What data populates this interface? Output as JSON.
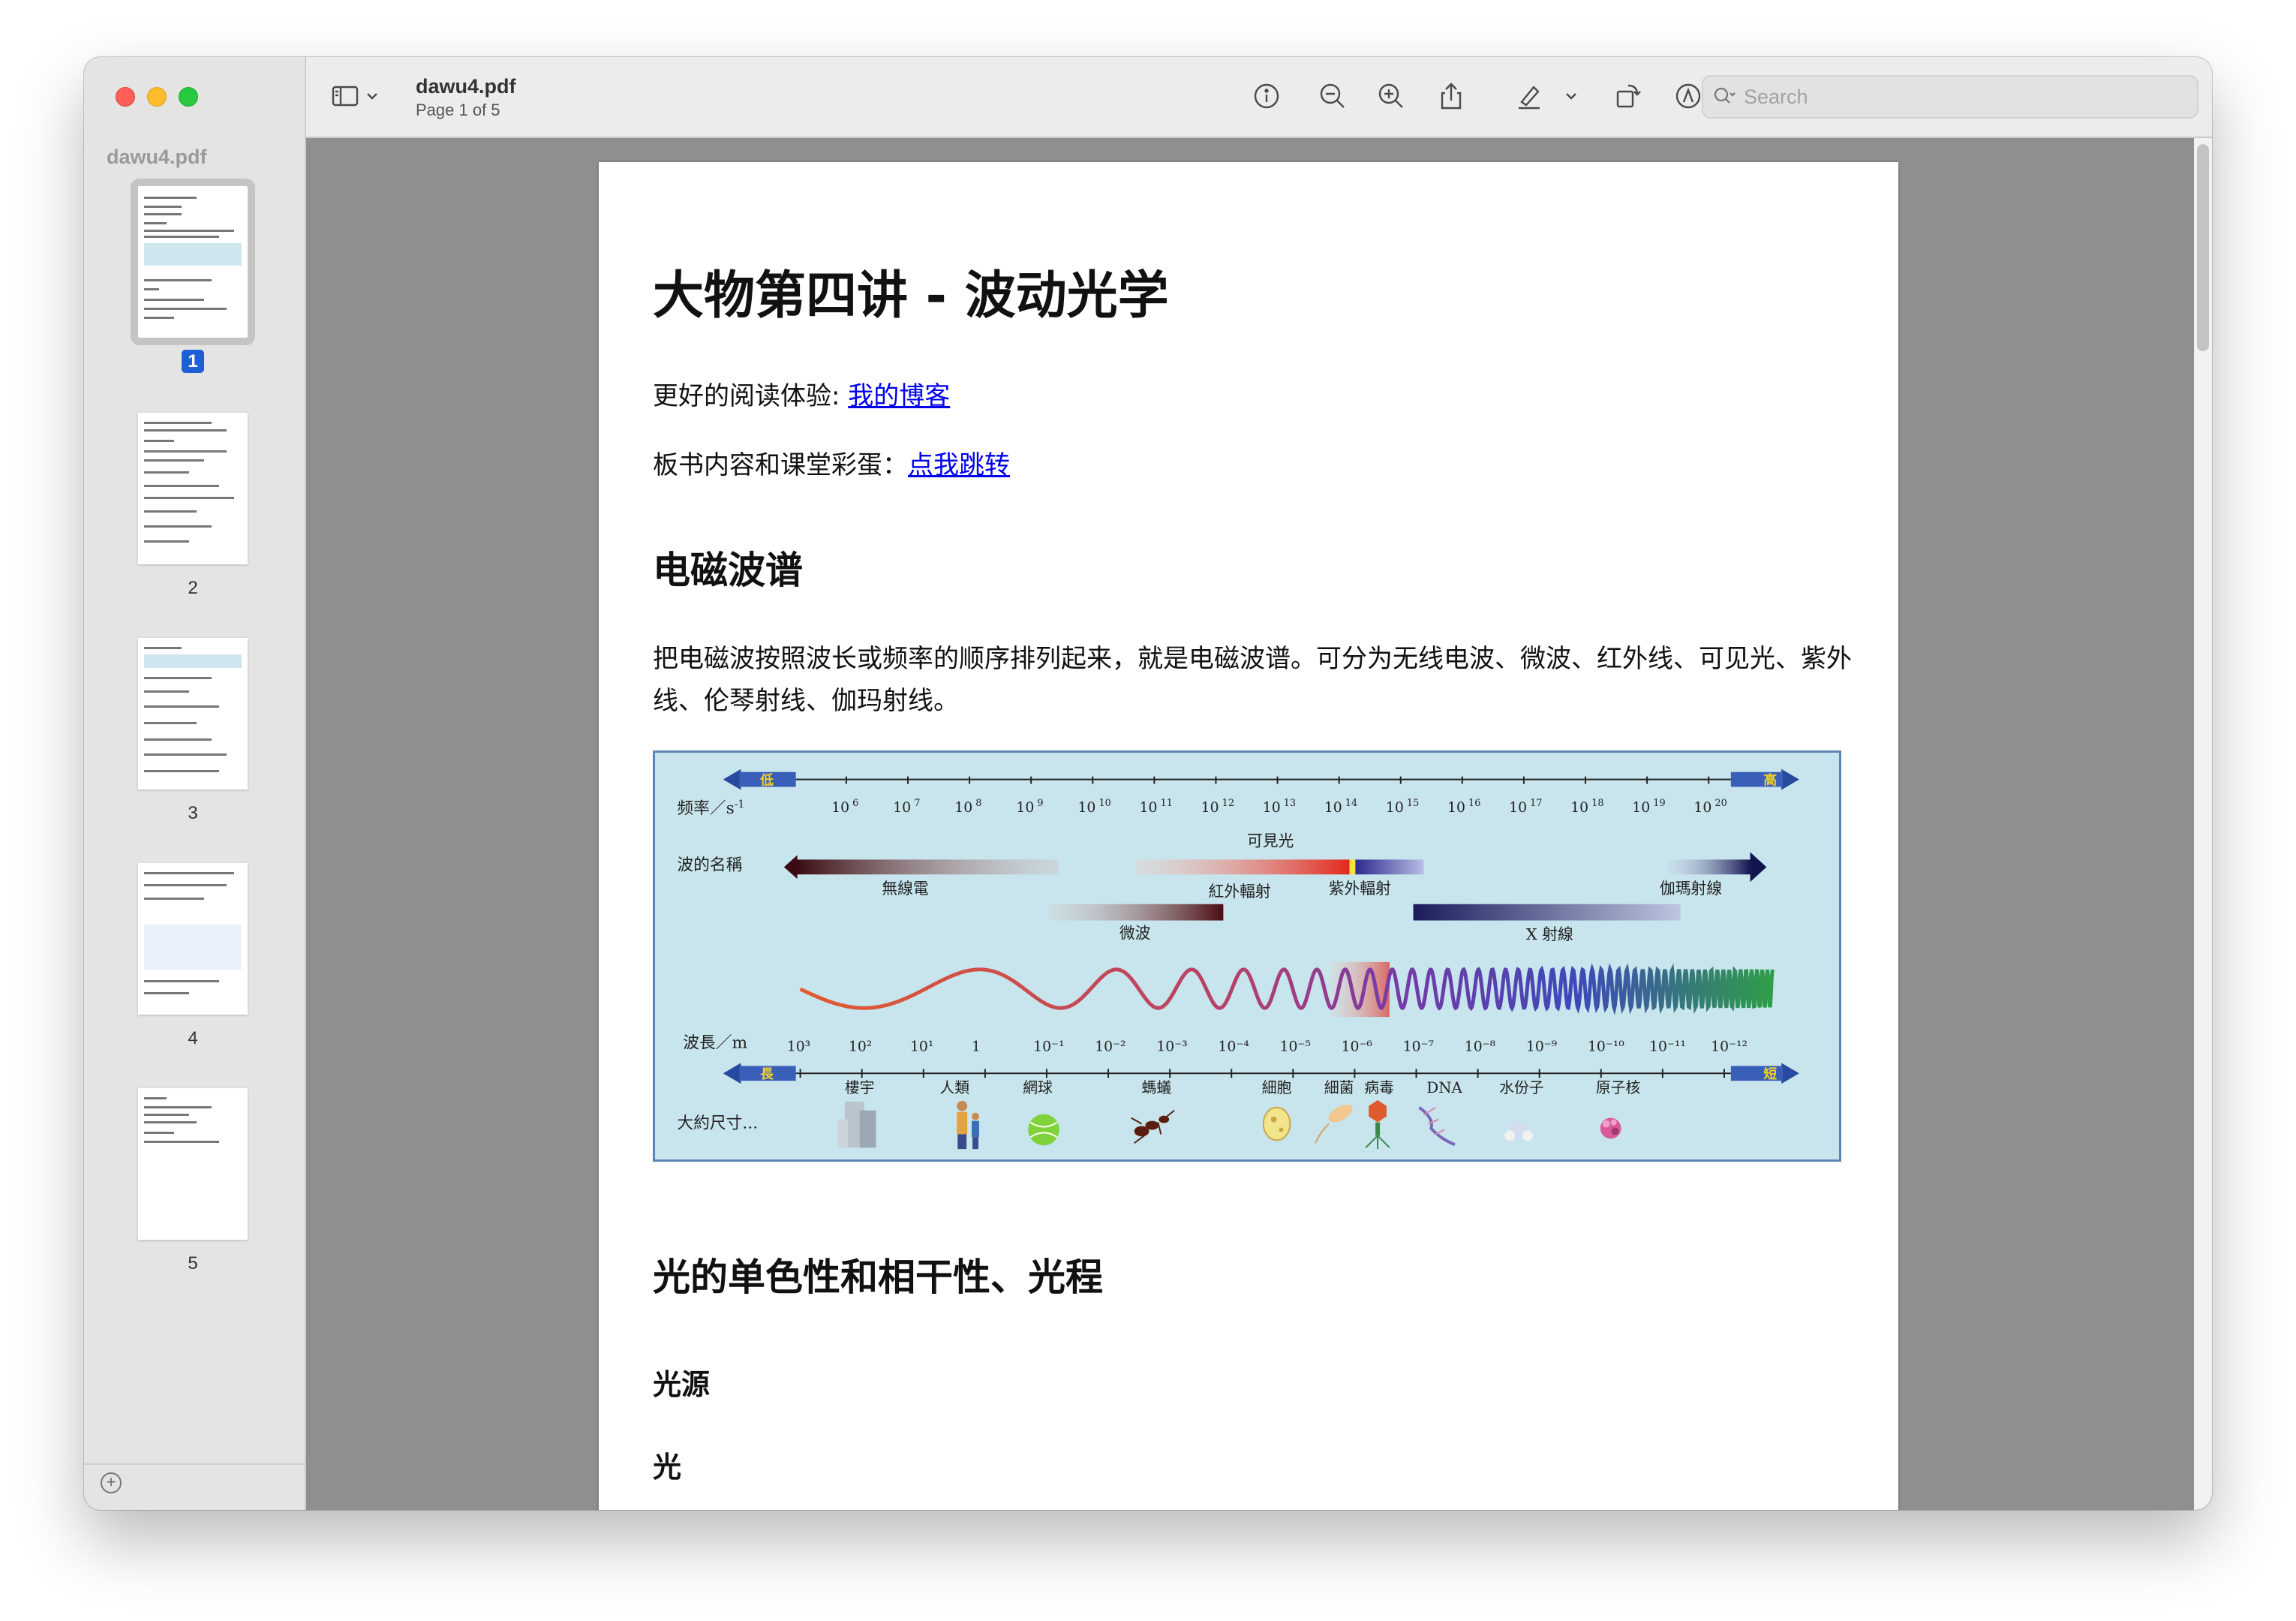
{
  "window": {
    "doc_title": "dawu4.pdf",
    "doc_subtitle": "Page 1 of 5",
    "search_placeholder": "Search"
  },
  "sidebar": {
    "title": "dawu4.pdf",
    "pages": [
      {
        "label": "1",
        "selected": true
      },
      {
        "label": "2"
      },
      {
        "label": "3"
      },
      {
        "label": "4"
      },
      {
        "label": "5"
      }
    ]
  },
  "toolbar": {
    "icons": [
      "sidebar-toggle-icon",
      "chevron-down-icon",
      "info-icon",
      "zoom-out-icon",
      "zoom-in-icon",
      "share-icon",
      "highlight-icon",
      "chevron-down-icon",
      "rotate-icon",
      "markup-icon",
      "form-fill-icon",
      "search-icon"
    ]
  },
  "page": {
    "title": "大物第四讲 - 波动光学",
    "line1_prefix": "更好的阅读体验: ",
    "line1_link": "我的博客",
    "line2_prefix": "板书内容和课堂彩蛋：",
    "line2_link": "点我跳转",
    "section1": "电磁波谱",
    "section1_text": "把电磁波按照波长或频率的顺序排列起来，就是电磁波谱。可分为无线电波、微波、红外线、可见光、紫外线、伦琴射线、伽玛射线。",
    "section2": "光的单色性和相干性、光程",
    "sub1": "光源",
    "sub2": "光"
  },
  "spectrum": {
    "low": "低",
    "high": "高",
    "freq_label": "频率／s",
    "freq_unit_sup": "-1",
    "freq_ticks": [
      "10 6",
      "10 7",
      "10 8",
      "10 9",
      "10 10",
      "10 11",
      "10 12",
      "10 13",
      "10 14",
      "10 15",
      "10 16",
      "10 17",
      "10 18",
      "10 19",
      "10 20"
    ],
    "wave_name_label": "波的名稱",
    "visible": "可見光",
    "radio": "無線電",
    "infrared": "紅外輻射",
    "uv": "紫外輻射",
    "gamma": "伽瑪射線",
    "microwave": "微波",
    "xray": "X 射線",
    "wavelength_label": "波長／m",
    "wl_ticks": [
      "10³",
      "10²",
      "10¹",
      "1",
      "10⁻¹",
      "10⁻²",
      "10⁻³",
      "10⁻⁴",
      "10⁻⁵",
      "10⁻⁶",
      "10⁻⁷",
      "10⁻⁸",
      "10⁻⁹",
      "10⁻¹⁰",
      "10⁻¹¹",
      "10⁻¹²"
    ],
    "long": "長",
    "short": "短",
    "size_label": "大約尺寸...",
    "objects": [
      "樓宇",
      "人類",
      "網球",
      "螞蟻",
      "細胞",
      "細菌",
      "病毒",
      "DNA",
      "水份子",
      "原子核"
    ]
  }
}
